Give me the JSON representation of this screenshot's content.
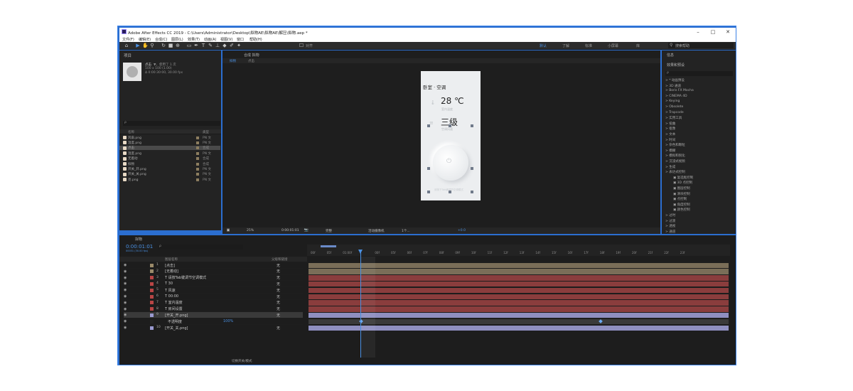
{
  "window": {
    "title": "Adobe After Effects CC 2019 - C:\\Users\\Administrator\\Desktop\\拟物AE\\拟物AE\\解压\\拟物.aep *",
    "minimize": "–",
    "maximize": "□",
    "close": "✕"
  },
  "menu": [
    "文件(F)",
    "编辑(E)",
    "合成(C)",
    "图层(L)",
    "效果(T)",
    "动画(A)",
    "视图(V)",
    "窗口",
    "帮助(H)"
  ],
  "toolbar": {
    "workspaces": [
      "默认",
      "了解",
      "标准",
      "小屏幕",
      "库"
    ],
    "active_workspace": "默认",
    "search_help": "搜索帮助",
    "align_label": "对齐"
  },
  "project": {
    "title": "项目",
    "selected_name": "点击",
    "used_label": "▼，使用了 1 次",
    "size_info": "100 x 100 (1.00)",
    "duration_info": "Δ 0:00:30:00, 30.00 fps",
    "search_placeholder": "ρ",
    "col_name": "名称",
    "col_type": "类型",
    "items": [
      {
        "name": "风扇.png",
        "type": "PN 文",
        "color": "#8c7d5f"
      },
      {
        "name": "温度.png",
        "type": "PN 文",
        "color": "#8c7d5f"
      },
      {
        "name": "点击",
        "type": "合成",
        "color": "#8c7d5f"
      },
      {
        "name": "温度.png",
        "type": "PN 文",
        "color": "#8c7d5f"
      },
      {
        "name": "无着动",
        "type": "合成",
        "color": "#8c7d5f"
      },
      {
        "name": "拟物",
        "type": "合成",
        "color": "#8c7d5f"
      },
      {
        "name": "开关_开.png",
        "type": "PN 文",
        "color": "#8c7d5f"
      },
      {
        "name": "开关_关.png",
        "type": "PN 文",
        "color": "#8c7d5f"
      },
      {
        "name": "亮.png",
        "type": "PN 文",
        "color": "#8c7d5f"
      }
    ],
    "bpc": "8 bpc"
  },
  "composition": {
    "panel_title": "合成 拟物",
    "tabs": [
      "拟物",
      "点击"
    ],
    "card_title": "卧室 · 空调",
    "temp_value": "28 ℃",
    "temp_sub": "室内温度",
    "level_value": "三级",
    "level_sub": "空调风速",
    "bottom_text": "请按下Tab键调节空调模式",
    "footer": {
      "zoom": "25%",
      "timecode": "0:00:01:01",
      "quality": "完整",
      "camera": "活动摄像机",
      "views": "1个...",
      "exposure": "+0.0"
    }
  },
  "effects": {
    "tab_info": "信息",
    "title": "效果和预设",
    "search_placeholder": "ρ",
    "items": [
      "> * 动画预设",
      "> 3D 通道",
      "> Boris FX Mocha",
      "> CINEMA 4D",
      "> Keying",
      "> Obsolete",
      "> Trapcode",
      "> 实用工具",
      "> 扭曲",
      "> 抠像",
      "> 文本",
      "> 时间",
      "> 杂色和颗粒",
      "> 模糊",
      "> 模拟和锐化",
      "> 沉浸式视频",
      "> 生成",
      "> 表达式控制"
    ],
    "expression_controls": [
      "复选框控制",
      "3D 点控制",
      "图层控制",
      "滑块控制",
      "点控制",
      "角度控制",
      "颜色控制"
    ],
    "items_after": [
      "> 过时",
      "> 过渡",
      "> 透视",
      "> 通道"
    ]
  },
  "timeline": {
    "tab": "拟物",
    "timecode": "0:00:01:01",
    "frame_info": "00031 (30.00 fps)",
    "search_placeholder": "ρ",
    "col_layer_name": "图层名称",
    "col_parent": "父级和链接",
    "ruler": [
      "00f",
      "05f",
      "01:00f",
      "",
      "00f",
      "05f",
      "06f",
      "07f",
      "08f",
      "09f",
      "10f",
      "11f",
      "12f",
      "13f",
      "14f",
      "15f",
      "16f",
      "17f",
      "18f",
      "19f",
      "20f",
      "21f",
      "22f",
      "23f"
    ],
    "layers": [
      {
        "num": "1",
        "name": "[点击]",
        "mode": "无",
        "label": "#9a8a6a",
        "bar": "#7a6e58"
      },
      {
        "num": "2",
        "name": "[无着动]",
        "mode": "无",
        "label": "#9a8a6a",
        "bar": "#7a6e58"
      },
      {
        "num": "3",
        "name": "T 请按Tab键调节空调模式",
        "mode": "无",
        "label": "#b84545",
        "bar": "#8a3d3d"
      },
      {
        "num": "4",
        "name": "T 30",
        "mode": "无",
        "label": "#b84545",
        "bar": "#8a3d3d"
      },
      {
        "num": "5",
        "name": "T 风速",
        "mode": "无",
        "label": "#b84545",
        "bar": "#8a3d3d"
      },
      {
        "num": "6",
        "name": "T 00:00",
        "mode": "无",
        "label": "#b84545",
        "bar": "#8a3d3d"
      },
      {
        "num": "7",
        "name": "T 室内温度",
        "mode": "无",
        "label": "#b84545",
        "bar": "#8a3d3d"
      },
      {
        "num": "8",
        "name": "T 房间设置",
        "mode": "无",
        "label": "#b84545",
        "bar": "#8a3d3d"
      },
      {
        "num": "9",
        "name": "[开关_开.png]",
        "mode": "无",
        "label": "#9a9ad0",
        "bar": "#8f8fc0"
      },
      {
        "num": "",
        "name": "不透明度",
        "mode": "100%",
        "label": "#232323",
        "bar": "#3a3a3a"
      },
      {
        "num": "10",
        "name": "[开关_关.png]",
        "mode": "无",
        "label": "#9a9ad0",
        "bar": "#8f8fc0"
      }
    ],
    "footer_toggle": "切换开关/模式"
  }
}
